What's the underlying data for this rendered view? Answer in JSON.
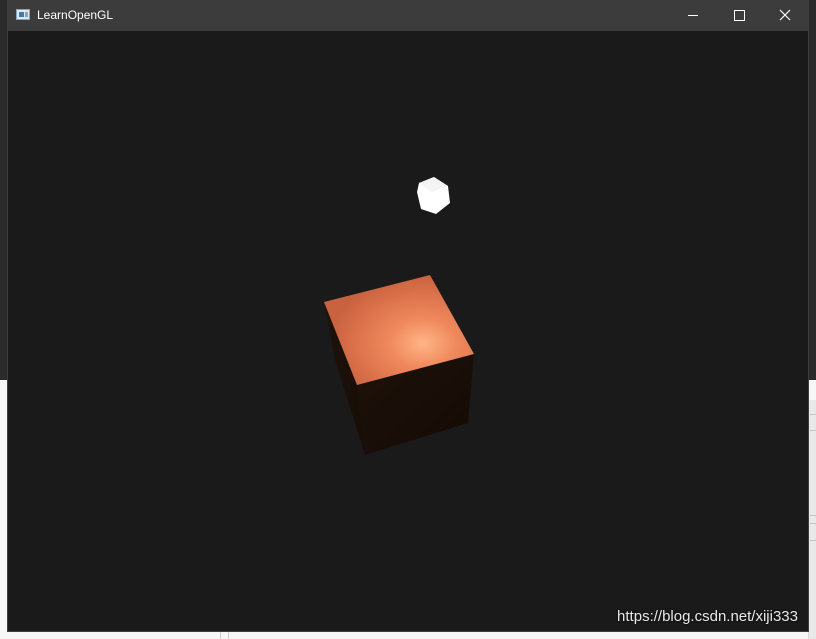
{
  "window": {
    "title": "LearnOpenGL",
    "controls": {
      "minimize_icon": "minimize-icon",
      "maximize_icon": "maximize-icon",
      "close_icon": "close-icon"
    }
  },
  "scene": {
    "background_color": "#1a1a1a",
    "objects": [
      {
        "name": "light-source-cube",
        "color": "#ffffff"
      },
      {
        "name": "lit-cube",
        "top_face_color": "#e07048",
        "highlight_color": "#ffb080",
        "side_color": "#1b1009"
      }
    ]
  },
  "overlay": {
    "watermark": "https://blog.csdn.net/xiji333"
  },
  "colors": {
    "titlebar": "#3c3c3c",
    "title_text": "#ffffff"
  }
}
